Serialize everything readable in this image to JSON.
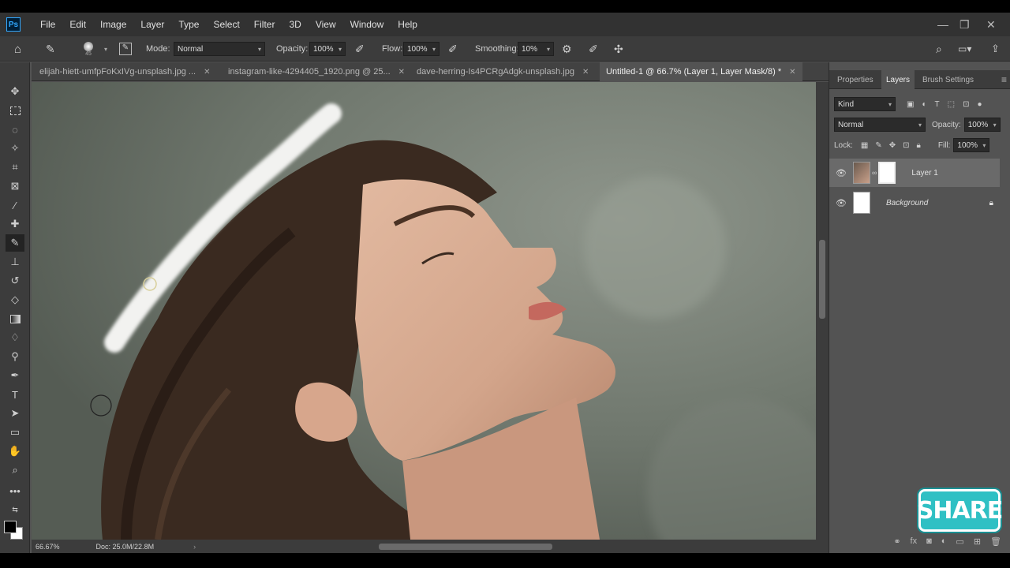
{
  "menu": {
    "app_logo": "Ps",
    "items": [
      "File",
      "Edit",
      "Image",
      "Layer",
      "Type",
      "Select",
      "Filter",
      "3D",
      "View",
      "Window",
      "Help"
    ]
  },
  "window_controls": {
    "minimize": "—",
    "restore": "❐",
    "close": "✕"
  },
  "options": {
    "brush_size": "45",
    "mode_label": "Mode:",
    "mode_value": "Normal",
    "opacity_label": "Opacity:",
    "opacity_value": "100%",
    "flow_label": "Flow:",
    "flow_value": "100%",
    "smoothing_label": "Smoothing:",
    "smoothing_value": "10%"
  },
  "tabs": [
    {
      "label": "elijah-hiett-umfpFoKxIVg-unsplash.jpg ...",
      "close": "✕"
    },
    {
      "label": "instagram-like-4294405_1920.png @ 25...",
      "close": "✕"
    },
    {
      "label": "dave-herring-Is4PCRgAdgk-unsplash.jpg",
      "close": "✕"
    },
    {
      "label": "Untitled-1 @ 66.7% (Layer 1, Layer Mask/8) *",
      "close": "✕"
    }
  ],
  "status": {
    "zoom": "66.67%",
    "doc": "Doc: 25.0M/22.8M"
  },
  "panel": {
    "tabs": [
      "Properties",
      "Layers",
      "Brush Settings"
    ],
    "filter_kind": "Kind",
    "blend_mode": "Normal",
    "opacity_label": "Opacity:",
    "opacity_value": "100%",
    "lock_label": "Lock:",
    "fill_label": "Fill:",
    "fill_value": "100%",
    "layers": [
      {
        "name": "Layer 1"
      },
      {
        "name": "Background"
      }
    ]
  },
  "overlay": {
    "share": "SHARE"
  },
  "colors": {
    "accent": "#31a8ff",
    "panel": "#535353",
    "share": "#2fc0c4"
  }
}
